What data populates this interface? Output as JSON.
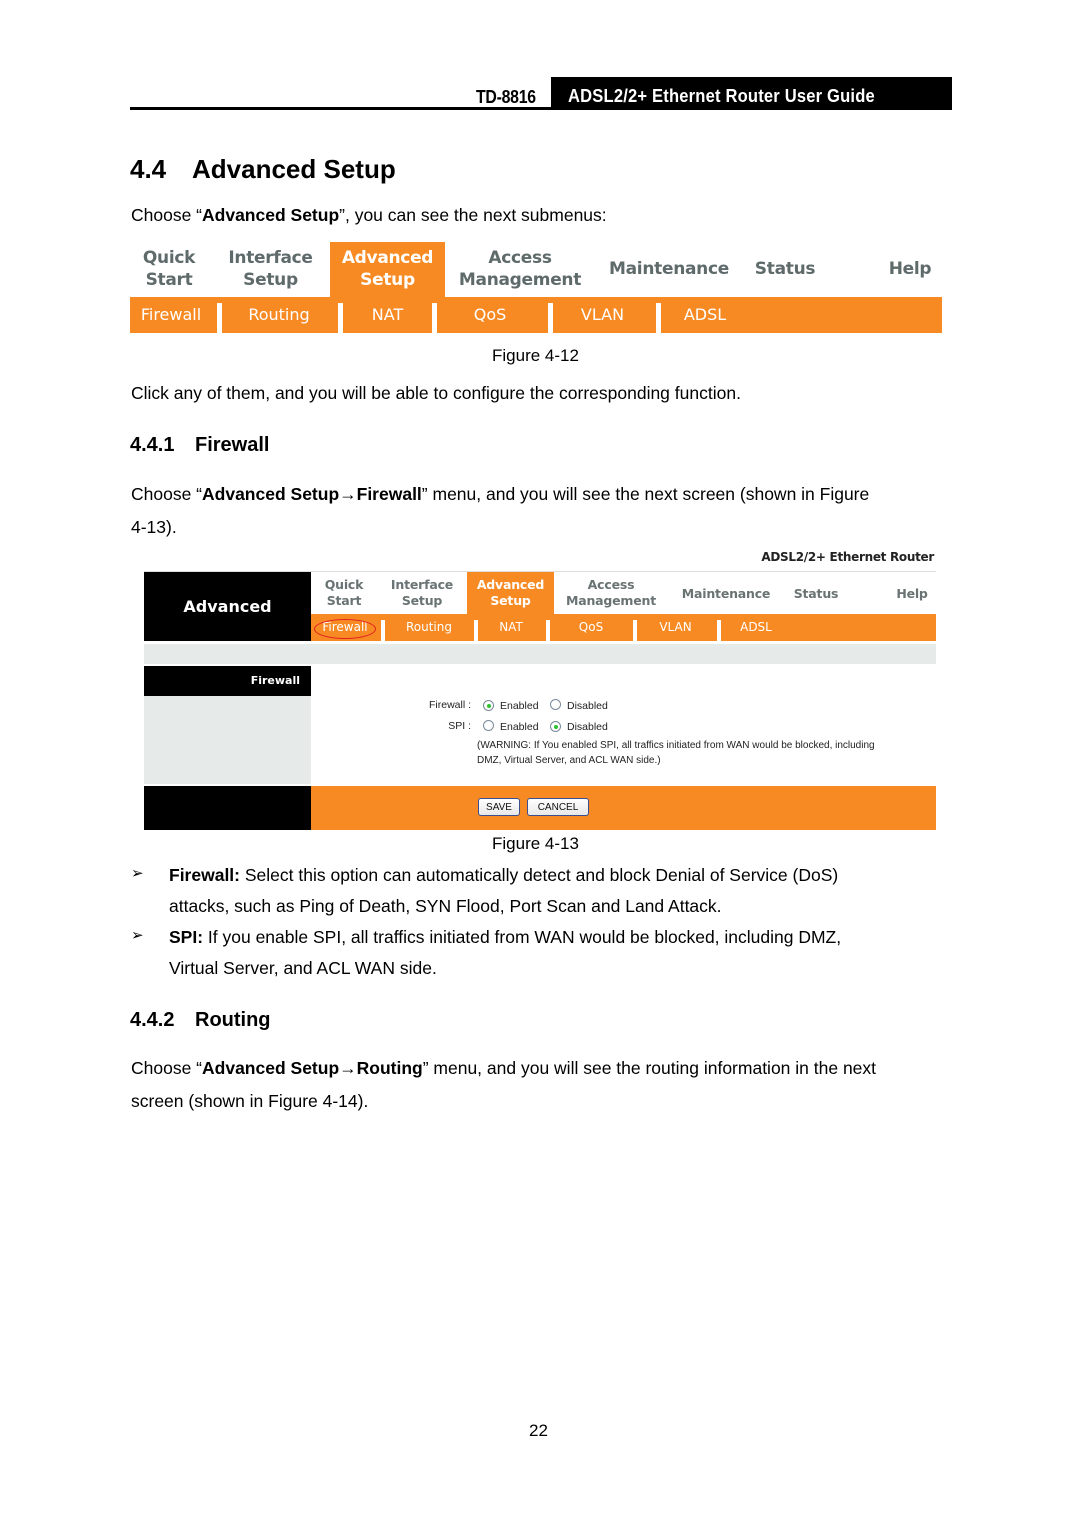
{
  "header": {
    "model": "TD-8816",
    "title": "ADSL2/2+  Ethernet  Router  User  Guide"
  },
  "section": {
    "number": "4.4",
    "title": "Advanced Setup",
    "intro": {
      "prefix": "Choose “",
      "bold": "Advanced Setup",
      "suffix": "”, you can see the next submenus:"
    }
  },
  "figure_12": {
    "caption": "Figure 4-12",
    "top_menu": [
      {
        "line1": "Quick",
        "line2": "Start",
        "active": false
      },
      {
        "line1": "Interface",
        "line2": "Setup",
        "active": false
      },
      {
        "line1": "Advanced",
        "line2": "Setup",
        "active": true
      },
      {
        "line1": "Access",
        "line2": "Management",
        "active": false
      },
      {
        "line1": "Maintenance",
        "line2": "",
        "active": false
      },
      {
        "line1": "Status",
        "line2": "",
        "active": false
      },
      {
        "line1": "Help",
        "line2": "",
        "active": false
      }
    ],
    "sub_menu": [
      "Firewall",
      "Routing",
      "NAT",
      "QoS",
      "VLAN",
      "ADSL"
    ]
  },
  "after_fig12": "Click any of them, and you will be able to configure the corresponding function.",
  "subsection_firewall": {
    "number": "4.4.1",
    "title": "Firewall",
    "intro": {
      "prefix": "Choose “",
      "bold": "Advanced Setup→Firewall",
      "suffix": "” menu, and you will see the next screen (shown in Figure",
      "line2": "4-13)."
    }
  },
  "figure_13": {
    "caption": "Figure 4-13",
    "brand": "ADSL2/2+ Ethernet Router",
    "logo_text": "Advanced",
    "top_menu": [
      {
        "line1": "Quick",
        "line2": "Start",
        "active": false
      },
      {
        "line1": "Interface",
        "line2": "Setup",
        "active": false
      },
      {
        "line1": "Advanced",
        "line2": "Setup",
        "active": true
      },
      {
        "line1": "Access",
        "line2": "Management",
        "active": false
      },
      {
        "line1": "Maintenance",
        "line2": "",
        "active": false
      },
      {
        "line1": "Status",
        "line2": "",
        "active": false
      },
      {
        "line1": "Help",
        "line2": "",
        "active": false
      }
    ],
    "sub_menu": [
      "Firewall",
      "Routing",
      "NAT",
      "QoS",
      "VLAN",
      "ADSL"
    ],
    "highlighted_sub": "Firewall",
    "sidebar_heading": "Firewall",
    "form": {
      "firewall": {
        "label": "Firewall :",
        "options": [
          "Enabled",
          "Disabled"
        ],
        "selected": "Enabled"
      },
      "spi": {
        "label": "SPI :",
        "options": [
          "Enabled",
          "Disabled"
        ],
        "selected": "Disabled"
      },
      "warning_line1": "(WARNING: If You enabled SPI, all traffics initiated from WAN would be blocked, including",
      "warning_line2": "DMZ, Virtual Server, and ACL WAN side.)"
    },
    "buttons": {
      "save": "SAVE",
      "cancel": "CANCEL"
    }
  },
  "bullets": [
    {
      "bold": "Firewall:",
      "text": " Select this option can automatically detect and block Denial of Service (DoS)",
      "line2": "attacks, such as Ping of Death, SYN Flood, Port Scan and Land Attack."
    },
    {
      "bold": "SPI:",
      "text": " If you enable SPI, all traffics initiated from WAN would be blocked, including DMZ,",
      "line2": "Virtual Server, and ACL WAN side."
    }
  ],
  "bullet_glyph": "➢",
  "subsection_routing": {
    "number": "4.4.2",
    "title": "Routing",
    "intro": {
      "prefix": "Choose “",
      "bold": "Advanced Setup→Routing",
      "suffix": "” menu, and you will see the routing information in the next",
      "line2": "screen (shown in Figure 4-14)."
    }
  },
  "page_number": "22"
}
